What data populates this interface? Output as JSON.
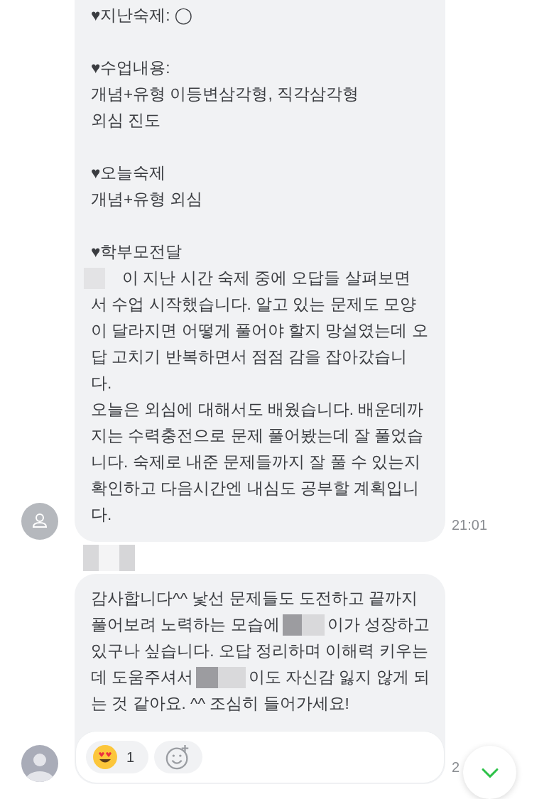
{
  "messages": [
    {
      "kind": "outline",
      "lines": [
        {
          "kind": "text",
          "segments": [
            {
              "kind": "text",
              "text": "♥지난숙제: ◯"
            }
          ]
        },
        {
          "kind": "blank"
        },
        {
          "kind": "text",
          "segments": [
            {
              "kind": "text",
              "text": "♥수업내용:"
            }
          ]
        },
        {
          "kind": "text",
          "segments": [
            {
              "kind": "text",
              "text": "개념+유형 이등변삼각형, 직각삼각형"
            }
          ]
        },
        {
          "kind": "text",
          "segments": [
            {
              "kind": "text",
              "text": "외심 진도"
            }
          ]
        },
        {
          "kind": "blank"
        },
        {
          "kind": "text",
          "segments": [
            {
              "kind": "text",
              "text": "♥오늘숙제"
            }
          ]
        },
        {
          "kind": "text",
          "segments": [
            {
              "kind": "text",
              "text": "개념+유형 외심"
            }
          ]
        },
        {
          "kind": "blank"
        },
        {
          "kind": "text",
          "segments": [
            {
              "kind": "text",
              "text": "♥학부모전달"
            }
          ]
        },
        {
          "kind": "text",
          "segments": [
            {
              "kind": "redacted"
            },
            {
              "kind": "text",
              "text": "이 지난 시간 숙제 중에 오답들 살펴보면"
            }
          ]
        },
        {
          "kind": "text",
          "segments": [
            {
              "kind": "text",
              "text": "서 수업 시작했습니다. 알고 있는 문제도 모양"
            }
          ]
        },
        {
          "kind": "text",
          "segments": [
            {
              "kind": "text",
              "text": "이 달라지면 어떻게 풀어야 할지 망설였는데 오"
            }
          ]
        },
        {
          "kind": "text",
          "segments": [
            {
              "kind": "text",
              "text": "답 고치기 반복하면서 점점 감을 잡아갔습니"
            }
          ]
        },
        {
          "kind": "text",
          "segments": [
            {
              "kind": "text",
              "text": "다."
            }
          ]
        },
        {
          "kind": "text",
          "segments": [
            {
              "kind": "text",
              "text": "오늘은 외심에 대해서도 배웠습니다. 배운데까"
            }
          ]
        },
        {
          "kind": "text",
          "segments": [
            {
              "kind": "text",
              "text": "지는 수력충전으로 문제 풀어봤는데 잘 풀었습"
            }
          ]
        },
        {
          "kind": "text",
          "segments": [
            {
              "kind": "text",
              "text": "니다. 숙제로 내준 문제들까지 잘 풀 수 있는지"
            }
          ]
        },
        {
          "kind": "text",
          "segments": [
            {
              "kind": "text",
              "text": "확인하고 다음시간엔 내심도 공부할 계획입니"
            }
          ]
        },
        {
          "kind": "text",
          "segments": [
            {
              "kind": "text",
              "text": "다."
            }
          ]
        }
      ],
      "time": "21:01"
    },
    {
      "kind": "silhouette",
      "sender_redacted": true,
      "lines": [
        {
          "kind": "text",
          "segments": [
            {
              "kind": "text",
              "text": "감사합니다^^ 낯선 문제들도 도전하고 끝까지"
            }
          ]
        },
        {
          "kind": "text",
          "segments": [
            {
              "kind": "text",
              "text": "풀어보려 노력하는 모습에"
            },
            {
              "kind": "redacted"
            },
            {
              "kind": "text",
              "text": "이가 성장하고"
            }
          ]
        },
        {
          "kind": "text",
          "segments": [
            {
              "kind": "text",
              "text": "있구나 싶습니다. 오답 정리하며 이해력 키우는"
            }
          ]
        },
        {
          "kind": "text",
          "segments": [
            {
              "kind": "text",
              "text": "데 도움주셔서"
            },
            {
              "kind": "redacted"
            },
            {
              "kind": "text",
              "text": "이도 자신감 잃지 않게 되"
            }
          ]
        },
        {
          "kind": "text",
          "segments": [
            {
              "kind": "text",
              "text": "는 것 같아요. ^^ 조심히 들어가세요!"
            }
          ]
        }
      ],
      "reactions": [
        {
          "count": "1"
        }
      ],
      "time": "2"
    }
  ]
}
